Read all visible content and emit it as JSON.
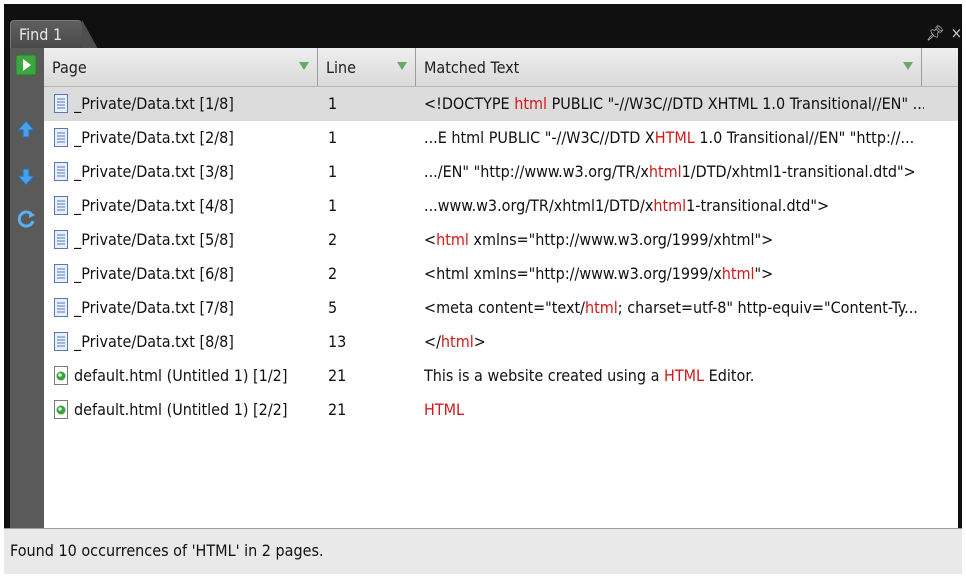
{
  "tab": {
    "label": "Find 1"
  },
  "columns": {
    "page": "Page",
    "line": "Line",
    "matched": "Matched Text"
  },
  "rows": [
    {
      "page": "_Private/Data.txt [1/8]",
      "line": "1",
      "icon": "text-file-icon",
      "pre": "<!DOCTYPE ",
      "match": "html",
      "post": " PUBLIC \"-//W3C//DTD XHTML 1.0 Transitional//EN\" ..."
    },
    {
      "page": "_Private/Data.txt [2/8]",
      "line": "1",
      "icon": "text-file-icon",
      "pre": "...E html PUBLIC \"-//W3C//DTD X",
      "match": "HTML",
      "post": " 1.0 Transitional//EN\" \"http://..."
    },
    {
      "page": "_Private/Data.txt [3/8]",
      "line": "1",
      "icon": "text-file-icon",
      "pre": ".../EN\" \"http://www.w3.org/TR/x",
      "match": "html",
      "post": "1/DTD/xhtml1-transitional.dtd\">"
    },
    {
      "page": "_Private/Data.txt [4/8]",
      "line": "1",
      "icon": "text-file-icon",
      "pre": "...www.w3.org/TR/xhtml1/DTD/x",
      "match": "html",
      "post": "1-transitional.dtd\">"
    },
    {
      "page": "_Private/Data.txt [5/8]",
      "line": "2",
      "icon": "text-file-icon",
      "pre": "<",
      "match": "html",
      "post": " xmlns=\"http://www.w3.org/1999/xhtml\">"
    },
    {
      "page": "_Private/Data.txt [6/8]",
      "line": "2",
      "icon": "text-file-icon",
      "pre": "<html xmlns=\"http://www.w3.org/1999/x",
      "match": "html",
      "post": "\">"
    },
    {
      "page": "_Private/Data.txt [7/8]",
      "line": "5",
      "icon": "text-file-icon",
      "pre": "<meta content=\"text/",
      "match": "html",
      "post": "; charset=utf-8\" http-equiv=\"Content-Ty..."
    },
    {
      "page": "_Private/Data.txt [8/8]",
      "line": "13",
      "icon": "text-file-icon",
      "pre": "</",
      "match": "html",
      "post": ">"
    },
    {
      "page": "default.html (Untitled 1) [1/2]",
      "line": "21",
      "icon": "html-file-icon",
      "pre": "This is a website created using a ",
      "match": "HTML",
      "post": " Editor."
    },
    {
      "page": "default.html (Untitled 1) [2/2]",
      "line": "21",
      "icon": "html-file-icon",
      "pre": "",
      "match": "HTML",
      "post": ""
    }
  ],
  "status": {
    "text": "Found 10 occurrences of 'HTML' in 2 pages."
  },
  "colors": {
    "match": "#d11a1a",
    "selection": "#dcdcdc",
    "toolbar": "#5a5a5a"
  }
}
